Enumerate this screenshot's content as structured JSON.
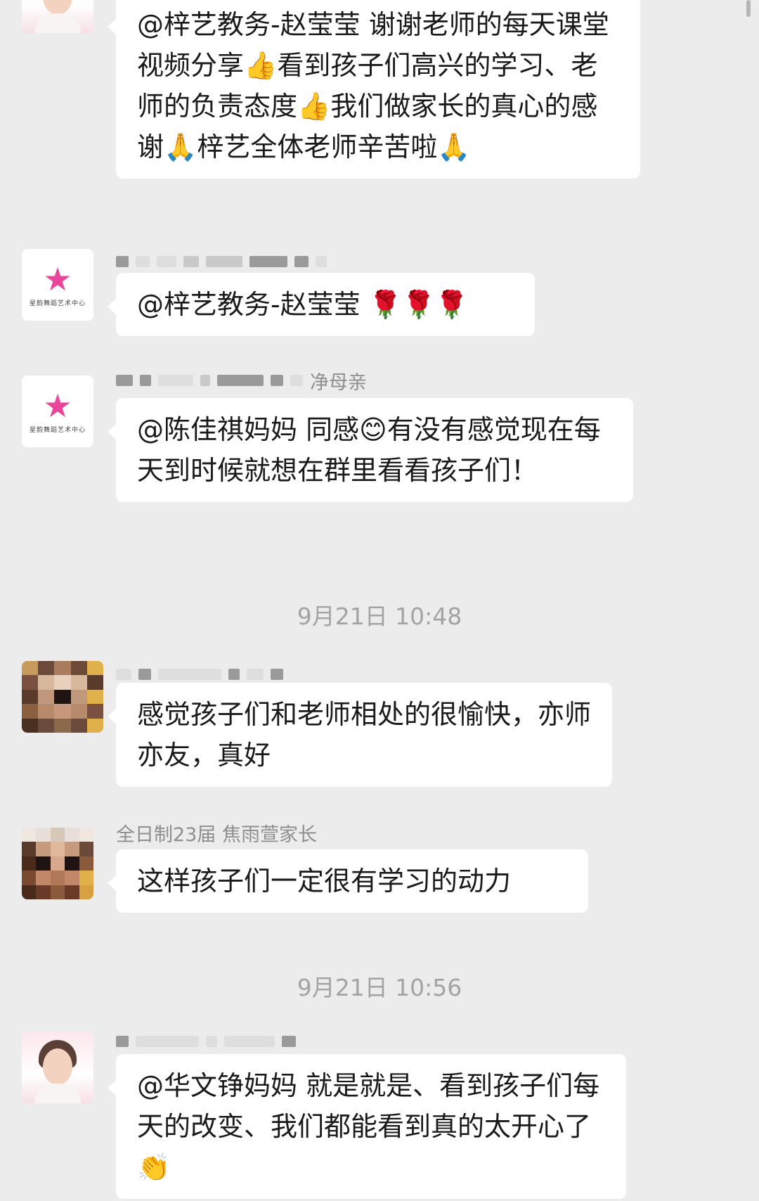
{
  "messages": [
    {
      "text": "@梓艺教务-赵莹莹 谢谢老师的每天课堂视频分享👍看到孩子们高兴的学习、老师的负责态度👍我们做家长的真心的感谢🙏梓艺全体老师辛苦啦🙏"
    },
    {
      "text": "@梓艺教务-赵莹莹 🌹🌹🌹"
    },
    {
      "sender_tail": "净母亲",
      "text": "@陈佳祺妈妈 同感😊有没有感觉现在每天到时候就想在群里看看孩子们！"
    },
    {
      "text": "感觉孩子们和老师相处的很愉快，亦师亦友，真好"
    },
    {
      "sender": "全日制23届 焦雨萱家长",
      "text": "这样孩子们一定很有学习的动力"
    },
    {
      "text": "@华文铮妈妈 就是就是、看到孩子们每天的改变、我们都能看到真的太开心了👏"
    }
  ],
  "timestamps": [
    "9月21日 10:48",
    "9月21日 10:56"
  ],
  "logo": {
    "text": "星韵舞蹈艺术中心",
    "icon": "star-logo-icon"
  },
  "colors": {
    "background": "#ececec",
    "bubble": "#ffffff",
    "meta_text": "#8e8e8e"
  }
}
